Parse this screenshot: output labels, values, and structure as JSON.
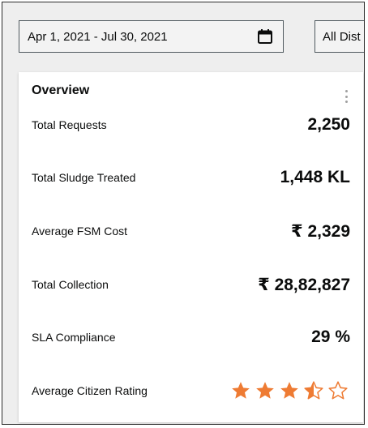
{
  "filters": {
    "date_range": "Apr 1, 2021 - Jul 30, 2021",
    "district": "All Dist"
  },
  "overview": {
    "title": "Overview",
    "rows": [
      {
        "label": "Total Requests",
        "value": "2,250"
      },
      {
        "label": "Total Sludge Treated",
        "value": "1,448 KL"
      },
      {
        "label": "Average FSM Cost",
        "value": "₹ 2,329"
      },
      {
        "label": "Total Collection",
        "value": "₹ 28,82,827"
      },
      {
        "label": "SLA Compliance",
        "value": "29 %"
      },
      {
        "label": "Average Citizen Rating",
        "rating": 3.5,
        "rating_max": 5
      }
    ]
  },
  "colors": {
    "star": "#ee7b33",
    "accent": "#ee7b33"
  },
  "icons": {
    "calendar": "calendar-icon",
    "menu": "kebab-menu-icon",
    "star": "star-icon"
  }
}
